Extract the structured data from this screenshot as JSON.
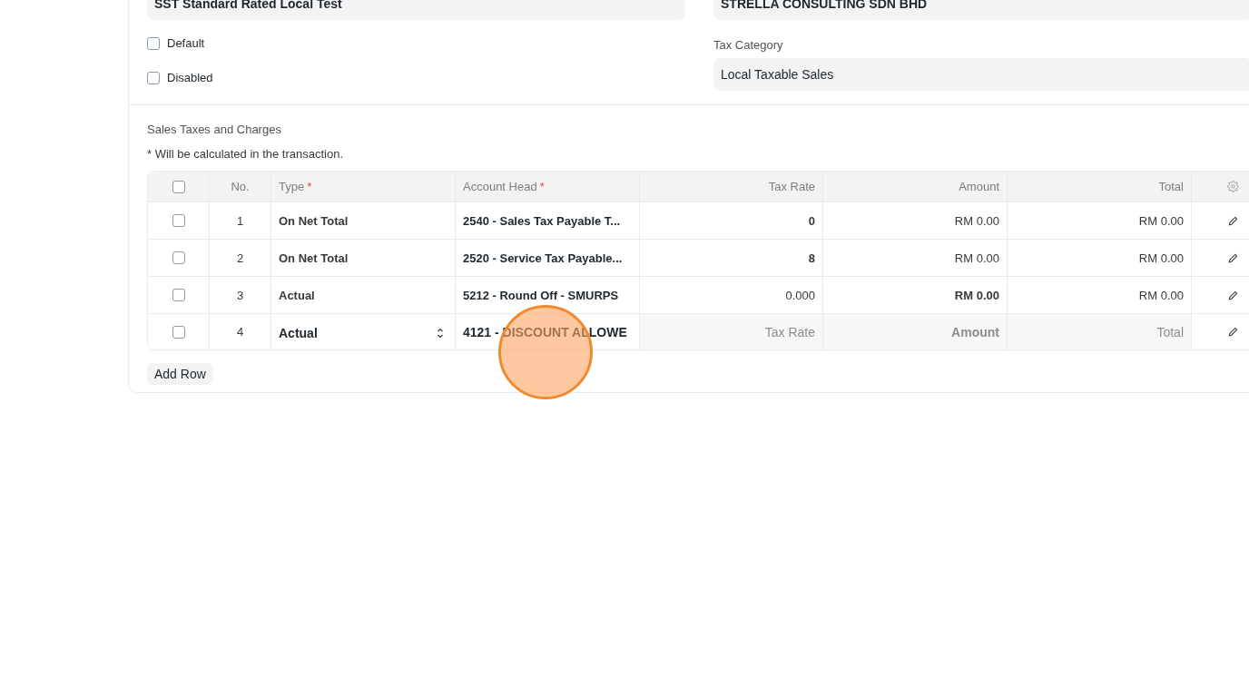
{
  "form": {
    "title_value": "SST Standard Rated Local Test",
    "company_value": "STRELLA CONSULTING SDN BHD",
    "checkboxes": [
      {
        "label": "Default",
        "checked": false
      },
      {
        "label": "Disabled",
        "checked": false
      }
    ],
    "tax_category": {
      "label": "Tax Category",
      "value": "Local Taxable Sales"
    }
  },
  "taxes": {
    "title": "Sales Taxes and Charges",
    "note": "* Will be calculated in the transaction.",
    "columns": [
      {
        "label": "No."
      },
      {
        "label": "Type",
        "required_mark": "*"
      },
      {
        "label": "Account Head",
        "required_mark": "*"
      },
      {
        "label": "Tax Rate"
      },
      {
        "label": "Amount"
      },
      {
        "label": "Total"
      }
    ],
    "header_checked": false,
    "rows": [
      {
        "no": "1",
        "checked": false,
        "editing": false,
        "type": "On Net Total",
        "account": "2540 - Sales Tax Payable T...",
        "tax_rate": {
          "text": "0",
          "bold": true
        },
        "amount": {
          "text": "RM 0.00",
          "bold": false
        },
        "total": "RM 0.00"
      },
      {
        "no": "2",
        "checked": false,
        "editing": false,
        "type": "On Net Total",
        "account": "2520 - Service Tax Payable...",
        "tax_rate": {
          "text": "8",
          "bold": true
        },
        "amount": {
          "text": "RM 0.00",
          "bold": false
        },
        "total": "RM 0.00"
      },
      {
        "no": "3",
        "checked": false,
        "editing": false,
        "type": "Actual",
        "account": "5212 - Round Off - SMURPS",
        "tax_rate": {
          "text": "0.000",
          "bold": false
        },
        "amount": {
          "text": "RM 0.00",
          "bold": true
        },
        "total": "RM 0.00"
      },
      {
        "no": "4",
        "checked": false,
        "editing": true,
        "type": "Actual",
        "account": "4121 - DISCOUNT ALLOWE",
        "tax_rate": {
          "placeholder": "Tax Rate"
        },
        "amount": {
          "placeholder": "Amount"
        },
        "total_placeholder": "Total"
      }
    ],
    "add_row": "Add Row"
  }
}
